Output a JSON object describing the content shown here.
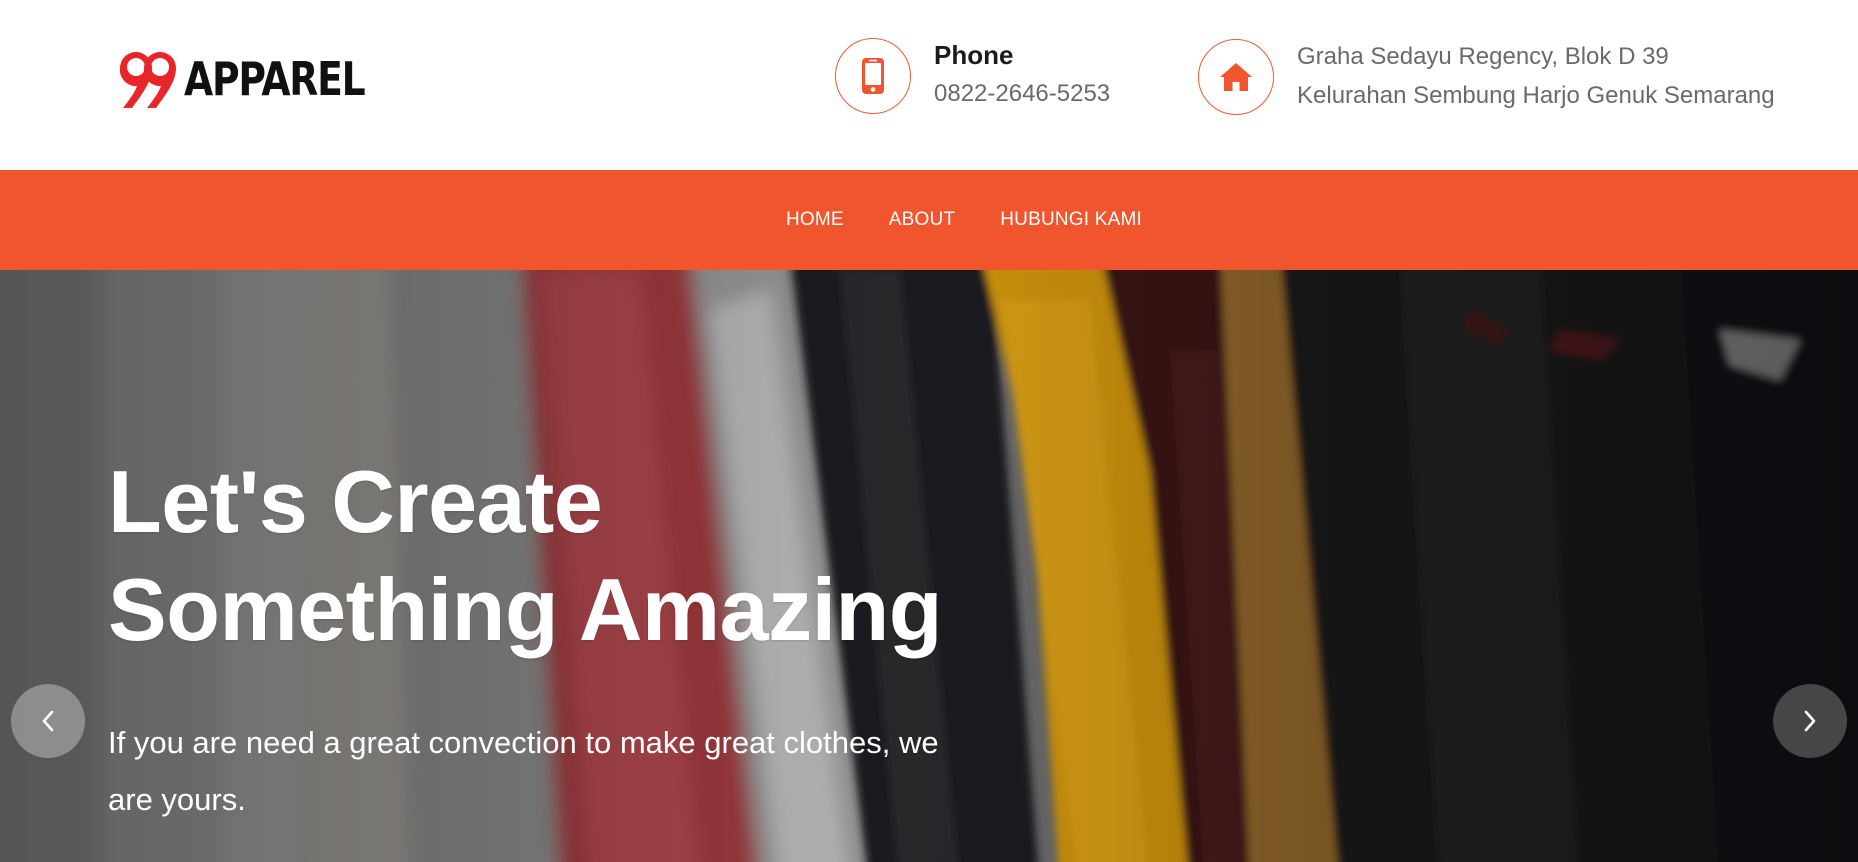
{
  "brand": {
    "logo_number": "99",
    "logo_text": "APPAREL",
    "accent_color": "#f0552d"
  },
  "contact": {
    "phone_icon": "mobile-phone-icon",
    "phone_title": "Phone",
    "phone_number": "0822-2646-5253",
    "address_icon": "home-icon",
    "address_line1": "Graha Sedayu Regency, Blok D 39",
    "address_line2": "Kelurahan Sembung Harjo Genuk Semarang"
  },
  "nav": {
    "items": [
      {
        "label": "HOME"
      },
      {
        "label": "ABOUT"
      },
      {
        "label": "HUBUNGI KAMI"
      }
    ]
  },
  "hero": {
    "title_line1": "Let's Create",
    "title_line2": "Something Amazing",
    "subtitle": "If you are need a great convection to make great clothes, we are yours.",
    "prev_icon": "chevron-left-icon",
    "next_icon": "chevron-right-icon",
    "background_image": "clothes-rack-photo"
  }
}
